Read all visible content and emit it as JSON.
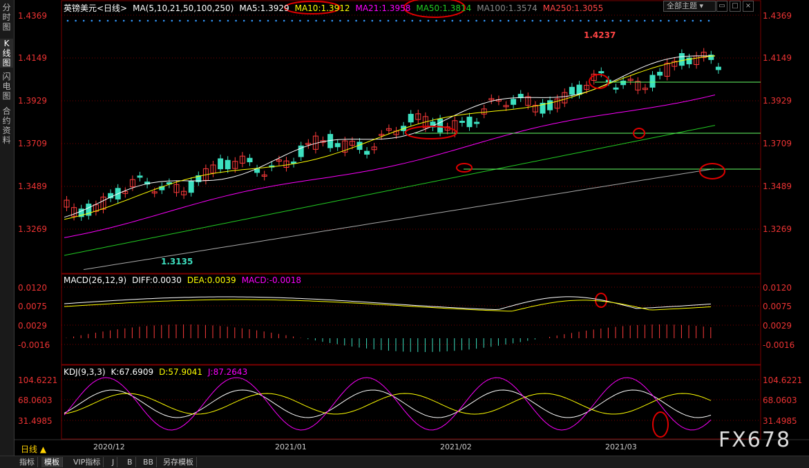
{
  "side_tabs": [
    "分时图",
    "K线图",
    "闪电图",
    "合约资料"
  ],
  "header": {
    "symbol": "英镑美元<日线>",
    "ma_label": "MA(5,10,21,50,100,250)",
    "ma5": "MA5:1.3929",
    "ma10": "MA10:1.3912",
    "ma21": "MA21:1.3958",
    "ma50": "MA50:1.3814",
    "ma100": "MA100:1.3574",
    "ma250": "MA250:1.3055",
    "theme": "全部主题",
    "win_buttons": [
      "▭",
      "□",
      "×"
    ]
  },
  "colors": {
    "up": "#ff3b3b",
    "down": "#3de0c0",
    "ma5": "#ffffff",
    "ma10": "#ffff00",
    "ma21": "#ff00ff",
    "ma50": "#22cc22",
    "ma100": "#aaaaaa",
    "axis_text": "#e33333",
    "grid": "#7a0000",
    "annotation": "#e00000",
    "hline": "#66ff66"
  },
  "chart_data": [
    {
      "type": "candlestick",
      "title": "英镑美元<日线>",
      "y_ticks": [
        "1.4369",
        "1.4149",
        "1.3929",
        "1.3709",
        "1.3489",
        "1.3269"
      ],
      "x_ticks": [
        "2020/12",
        "2021/01",
        "2021/02",
        "2021/03"
      ],
      "ma_values": {
        "MA5": 1.3929,
        "MA10": 1.3912,
        "MA21": 1.3958,
        "MA50": 1.3814,
        "MA100": 1.3574,
        "MA250": 1.3055
      },
      "annotations": [
        {
          "text": "1.4237",
          "value": 1.4237
        },
        {
          "text": "1.3135",
          "value": 1.3135
        }
      ]
    },
    {
      "type": "macd",
      "title": "MACD(26,12,9)",
      "values": {
        "DIFF": 0.003,
        "DEA": 0.0039,
        "MACD": -0.0018
      },
      "labels": {
        "diff": "DIFF:0.0030",
        "dea": "DEA:0.0039",
        "macd": "MACD:-0.0018"
      },
      "y_ticks": [
        "0.0120",
        "0.0075",
        "0.0029",
        "-0.0016"
      ]
    },
    {
      "type": "kdj",
      "title": "KDJ(9,3,3)",
      "values": {
        "K": 67.6909,
        "D": 57.9041,
        "J": 87.2643
      },
      "labels": {
        "k": "K:67.6909",
        "d": "D:57.9041",
        "j": "J:87.2643"
      },
      "y_ticks": [
        "104.6221",
        "68.0603",
        "31.4985"
      ]
    }
  ],
  "period": "日线 ▲",
  "bottom_tabs": [
    "指标",
    "模板",
    "VIP指标",
    "J",
    "B",
    "BB",
    "另存模板"
  ],
  "logo": "FX678"
}
